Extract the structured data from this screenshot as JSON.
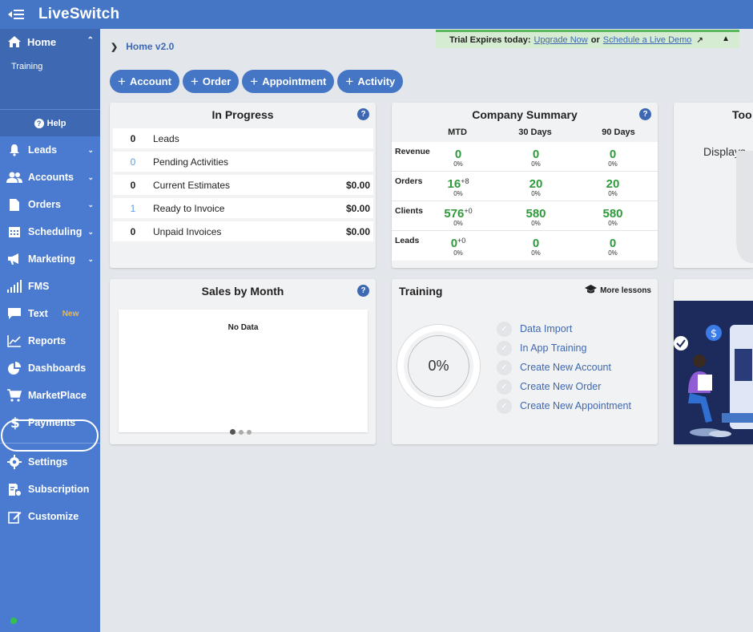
{
  "app": {
    "brand": "LiveSwitch"
  },
  "sidebar": {
    "home_label": "Home",
    "training_label": "Training",
    "help_label": "Help",
    "items": [
      {
        "label": "Leads",
        "icon": "bell-icon"
      },
      {
        "label": "Accounts",
        "icon": "users-icon"
      },
      {
        "label": "Orders",
        "icon": "document-icon"
      },
      {
        "label": "Scheduling",
        "icon": "calendar-icon"
      },
      {
        "label": "Marketing",
        "icon": "megaphone-icon"
      },
      {
        "label": "FMS",
        "icon": "signal-bars-icon"
      },
      {
        "label": "Text",
        "icon": "chat-bubble-icon",
        "badge": "New"
      },
      {
        "label": "Reports",
        "icon": "line-chart-icon"
      },
      {
        "label": "Dashboards",
        "icon": "pie-chart-icon"
      },
      {
        "label": "MarketPlace",
        "icon": "cart-icon"
      },
      {
        "label": "Payments",
        "icon": "dollar-icon"
      }
    ],
    "bottom_items": [
      {
        "label": "Settings",
        "icon": "gear-icon"
      },
      {
        "label": "Subscription",
        "icon": "subscription-icon"
      },
      {
        "label": "Customize",
        "icon": "edit-icon"
      }
    ]
  },
  "breadcrumb": {
    "current": "Home v2.0"
  },
  "trial": {
    "message": "Trial Expires today:",
    "upgrade_link": "Upgrade Now",
    "or_text": "or",
    "demo_link": "Schedule a Live Demo"
  },
  "quick_actions": [
    "Account",
    "Order",
    "Appointment",
    "Activity"
  ],
  "in_progress": {
    "title": "In Progress",
    "rows": [
      {
        "count": "0",
        "label": "Leads",
        "amount": ""
      },
      {
        "count": "0",
        "label": "Pending Activities",
        "amount": ""
      },
      {
        "count": "0",
        "label": "Current Estimates",
        "amount": "$0.00"
      },
      {
        "count": "1",
        "label": "Ready to Invoice",
        "amount": "$0.00"
      },
      {
        "count": "0",
        "label": "Unpaid Invoices",
        "amount": "$0.00"
      }
    ]
  },
  "company_summary": {
    "title": "Company Summary",
    "columns": [
      "MTD",
      "30 Days",
      "90 Days"
    ],
    "rows": [
      {
        "label": "Revenue",
        "values": [
          {
            "v": "0",
            "delta": "",
            "pct": "0%"
          },
          {
            "v": "0",
            "delta": "",
            "pct": "0%"
          },
          {
            "v": "0",
            "delta": "",
            "pct": "0%"
          }
        ]
      },
      {
        "label": "Orders",
        "values": [
          {
            "v": "16",
            "delta": "+8",
            "pct": "0%"
          },
          {
            "v": "20",
            "delta": "",
            "pct": "0%"
          },
          {
            "v": "20",
            "delta": "",
            "pct": "0%"
          }
        ]
      },
      {
        "label": "Clients",
        "values": [
          {
            "v": "576",
            "delta": "+0",
            "pct": "0%"
          },
          {
            "v": "580",
            "delta": "",
            "pct": "0%"
          },
          {
            "v": "580",
            "delta": "",
            "pct": "0%"
          }
        ]
      },
      {
        "label": "Leads",
        "values": [
          {
            "v": "0",
            "delta": "+0",
            "pct": "0%"
          },
          {
            "v": "0",
            "delta": "",
            "pct": "0%"
          },
          {
            "v": "0",
            "delta": "",
            "pct": "0%"
          }
        ]
      }
    ]
  },
  "partial_card": {
    "title": "Too",
    "text": "Displays"
  },
  "sales_by_month": {
    "title": "Sales by Month",
    "empty_text": "No Data"
  },
  "training": {
    "title": "Training",
    "more_lessons": "More lessons",
    "progress_label": "0%",
    "progress": 0,
    "lessons": [
      "Data Import",
      "In App Training",
      "Create New Account",
      "Create New Order",
      "Create New Appointment"
    ]
  },
  "colors": {
    "primary": "#4576c5",
    "sidebar": "#4a7bd0",
    "positive": "#2e9a3b",
    "trial_bg": "#d6ecd2"
  }
}
